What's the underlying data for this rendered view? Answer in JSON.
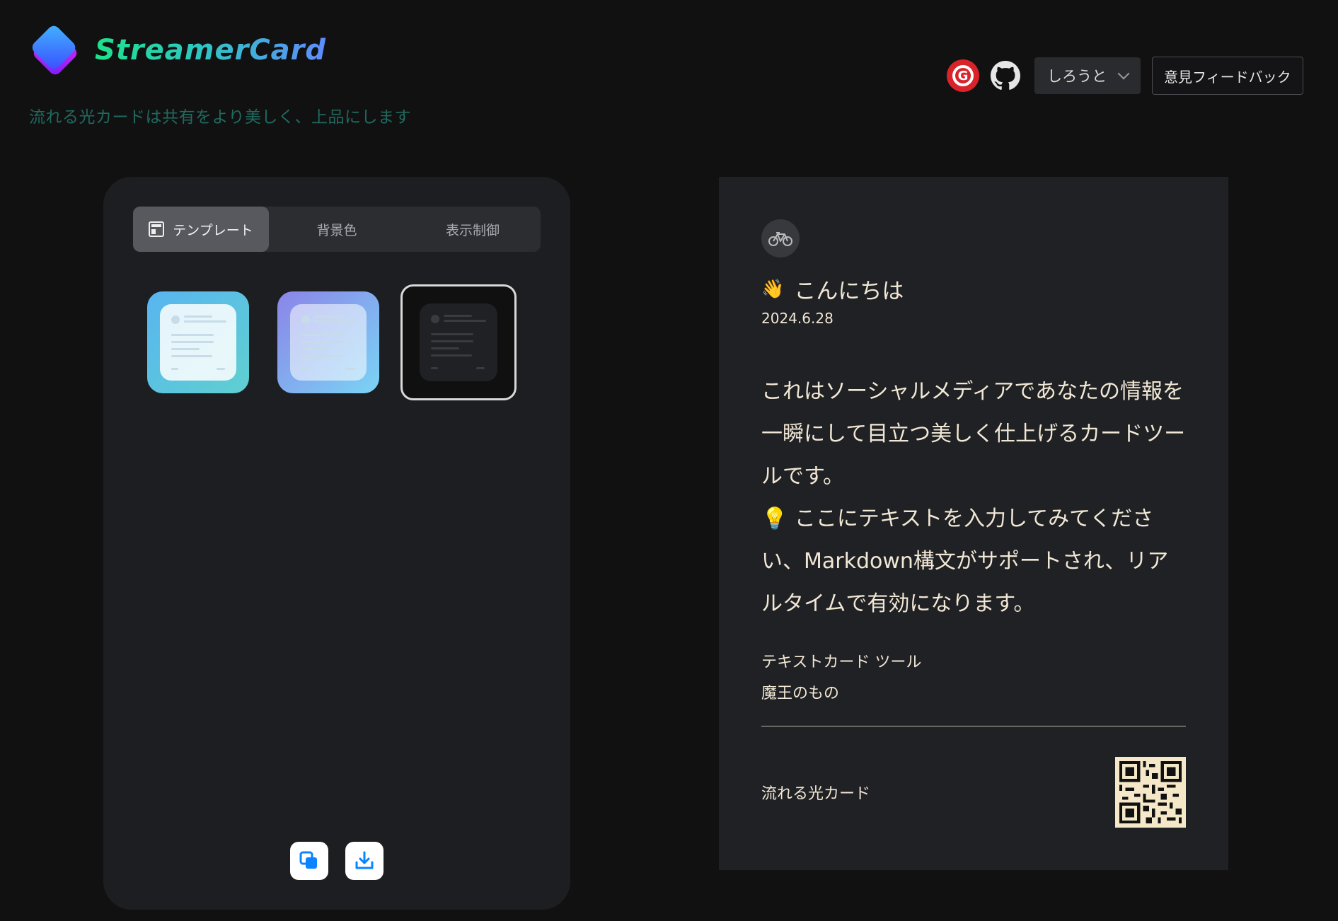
{
  "header": {
    "brand": "StreamerCard",
    "tagline": "流れる光カードは共有をより美しく、上品にします",
    "language": "しろうと",
    "feedback": "意見フィードバック"
  },
  "editor": {
    "tabs": [
      {
        "label": "テンプレート",
        "active": true
      },
      {
        "label": "背景色",
        "active": false
      },
      {
        "label": "表示制御",
        "active": false
      }
    ],
    "templates": [
      {
        "name": "light-gradient",
        "selected": false
      },
      {
        "name": "purple-gradient",
        "selected": false
      },
      {
        "name": "dark",
        "selected": true
      }
    ]
  },
  "card": {
    "greeting_emoji": "👋",
    "greeting": "こんにちは",
    "date": "2024.6.28",
    "body_line1": "これはソーシャルメディアであなたの情報を一瞬にして目立つ美しく仕上げるカードツールです。",
    "body_line2": "💡 ここにテキストを入力してみてください、Markdown構文がサポートされ、リアルタイムで有効になります。",
    "meta_title": "テキストカード ツール",
    "meta_author": "魔王のもの",
    "footer_label": "流れる光カード"
  },
  "colors": {
    "background": "#111112",
    "card_bg": "#202124",
    "card_text": "#f1e7d5",
    "tagline": "#206a5f"
  }
}
